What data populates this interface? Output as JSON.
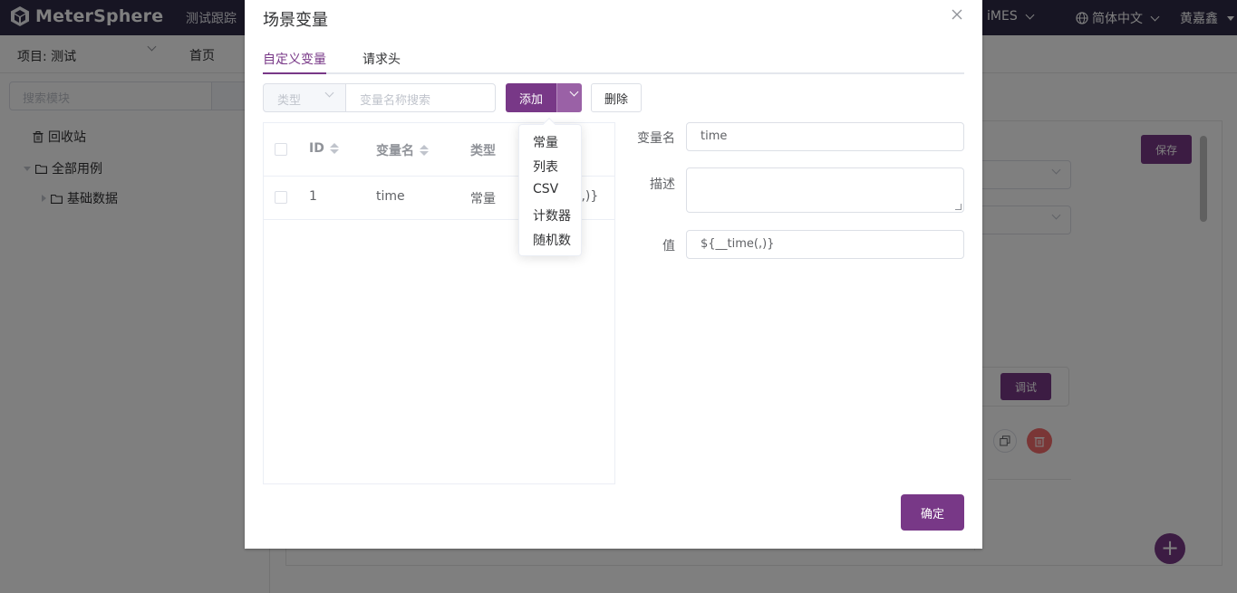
{
  "app": {
    "logo_text": "MeterSphere",
    "nav_item": "测试跟踪",
    "nav_right": "iMES",
    "language": "简体中文",
    "user": "黄嘉鑫"
  },
  "subbar": {
    "project": "项目: 测试",
    "home": "首页"
  },
  "sidebar": {
    "search_placeholder": "搜索模块",
    "tree": [
      {
        "label": "回收站"
      },
      {
        "label": "全部用例"
      },
      {
        "label": "基础数据"
      }
    ]
  },
  "background": {
    "save_label": "保存",
    "debug_label": "调试",
    "fab_label": "+"
  },
  "dialog": {
    "title": "场景变量",
    "tabs": [
      {
        "label": "自定义变量",
        "active": true
      },
      {
        "label": "请求头",
        "active": false
      }
    ],
    "toolbar": {
      "type_placeholder": "类型",
      "search_placeholder": "变量名称搜索",
      "add_label": "添加",
      "delete_label": "删除"
    },
    "table": {
      "columns": [
        "ID",
        "变量名",
        "类型"
      ],
      "rows": [
        {
          "id": "1",
          "name": "time",
          "type": "常量",
          "value_tail": "(,)}"
        }
      ]
    },
    "add_menu": [
      "常量",
      "列表",
      "CSV",
      "计数器",
      "随机数"
    ],
    "form": {
      "name_label": "变量名",
      "name_value": "time",
      "desc_label": "描述",
      "desc_value": "",
      "value_label": "值",
      "value_value": "${__time(,)}"
    },
    "confirm_label": "确定"
  },
  "colors": {
    "primary": "#783887",
    "topbar": "#2e2a47",
    "danger": "#f56c6c"
  }
}
